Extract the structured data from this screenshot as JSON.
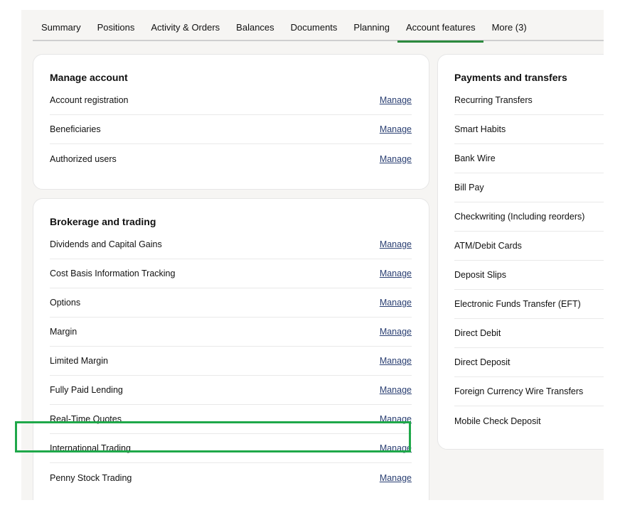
{
  "tabs": [
    {
      "label": "Summary",
      "active": false
    },
    {
      "label": "Positions",
      "active": false
    },
    {
      "label": "Activity & Orders",
      "active": false
    },
    {
      "label": "Balances",
      "active": false
    },
    {
      "label": "Documents",
      "active": false
    },
    {
      "label": "Planning",
      "active": false
    },
    {
      "label": "Account features",
      "active": true
    },
    {
      "label": "More (3)",
      "active": false
    }
  ],
  "manage_account": {
    "title": "Manage account",
    "rows": [
      {
        "label": "Account registration",
        "action": "Manage"
      },
      {
        "label": "Beneficiaries",
        "action": "Manage"
      },
      {
        "label": "Authorized users",
        "action": "Manage"
      }
    ]
  },
  "brokerage": {
    "title": "Brokerage and trading",
    "rows": [
      {
        "label": "Dividends and Capital Gains",
        "action": "Manage"
      },
      {
        "label": "Cost Basis Information Tracking",
        "action": "Manage"
      },
      {
        "label": "Options",
        "action": "Manage"
      },
      {
        "label": "Margin",
        "action": "Manage"
      },
      {
        "label": "Limited Margin",
        "action": "Manage"
      },
      {
        "label": "Fully Paid Lending",
        "action": "Manage"
      },
      {
        "label": "Real-Time Quotes",
        "action": "Manage"
      },
      {
        "label": "International Trading",
        "action": "Manage"
      },
      {
        "label": "Penny Stock Trading",
        "action": "Manage"
      }
    ]
  },
  "payments": {
    "title": "Payments and transfers",
    "rows": [
      {
        "label": "Recurring Transfers"
      },
      {
        "label": "Smart Habits"
      },
      {
        "label": "Bank Wire"
      },
      {
        "label": "Bill Pay"
      },
      {
        "label": "Checkwriting (Including reorders)"
      },
      {
        "label": "ATM/Debit Cards"
      },
      {
        "label": "Deposit Slips"
      },
      {
        "label": "Electronic Funds Transfer (EFT)"
      },
      {
        "label": "Direct Debit"
      },
      {
        "label": "Direct Deposit"
      },
      {
        "label": "Foreign Currency Wire Transfers"
      },
      {
        "label": "Mobile Check Deposit"
      }
    ]
  },
  "colors": {
    "accent": "#2c8a3e",
    "highlight": "#1fa84a",
    "link": "#2a3f72"
  }
}
